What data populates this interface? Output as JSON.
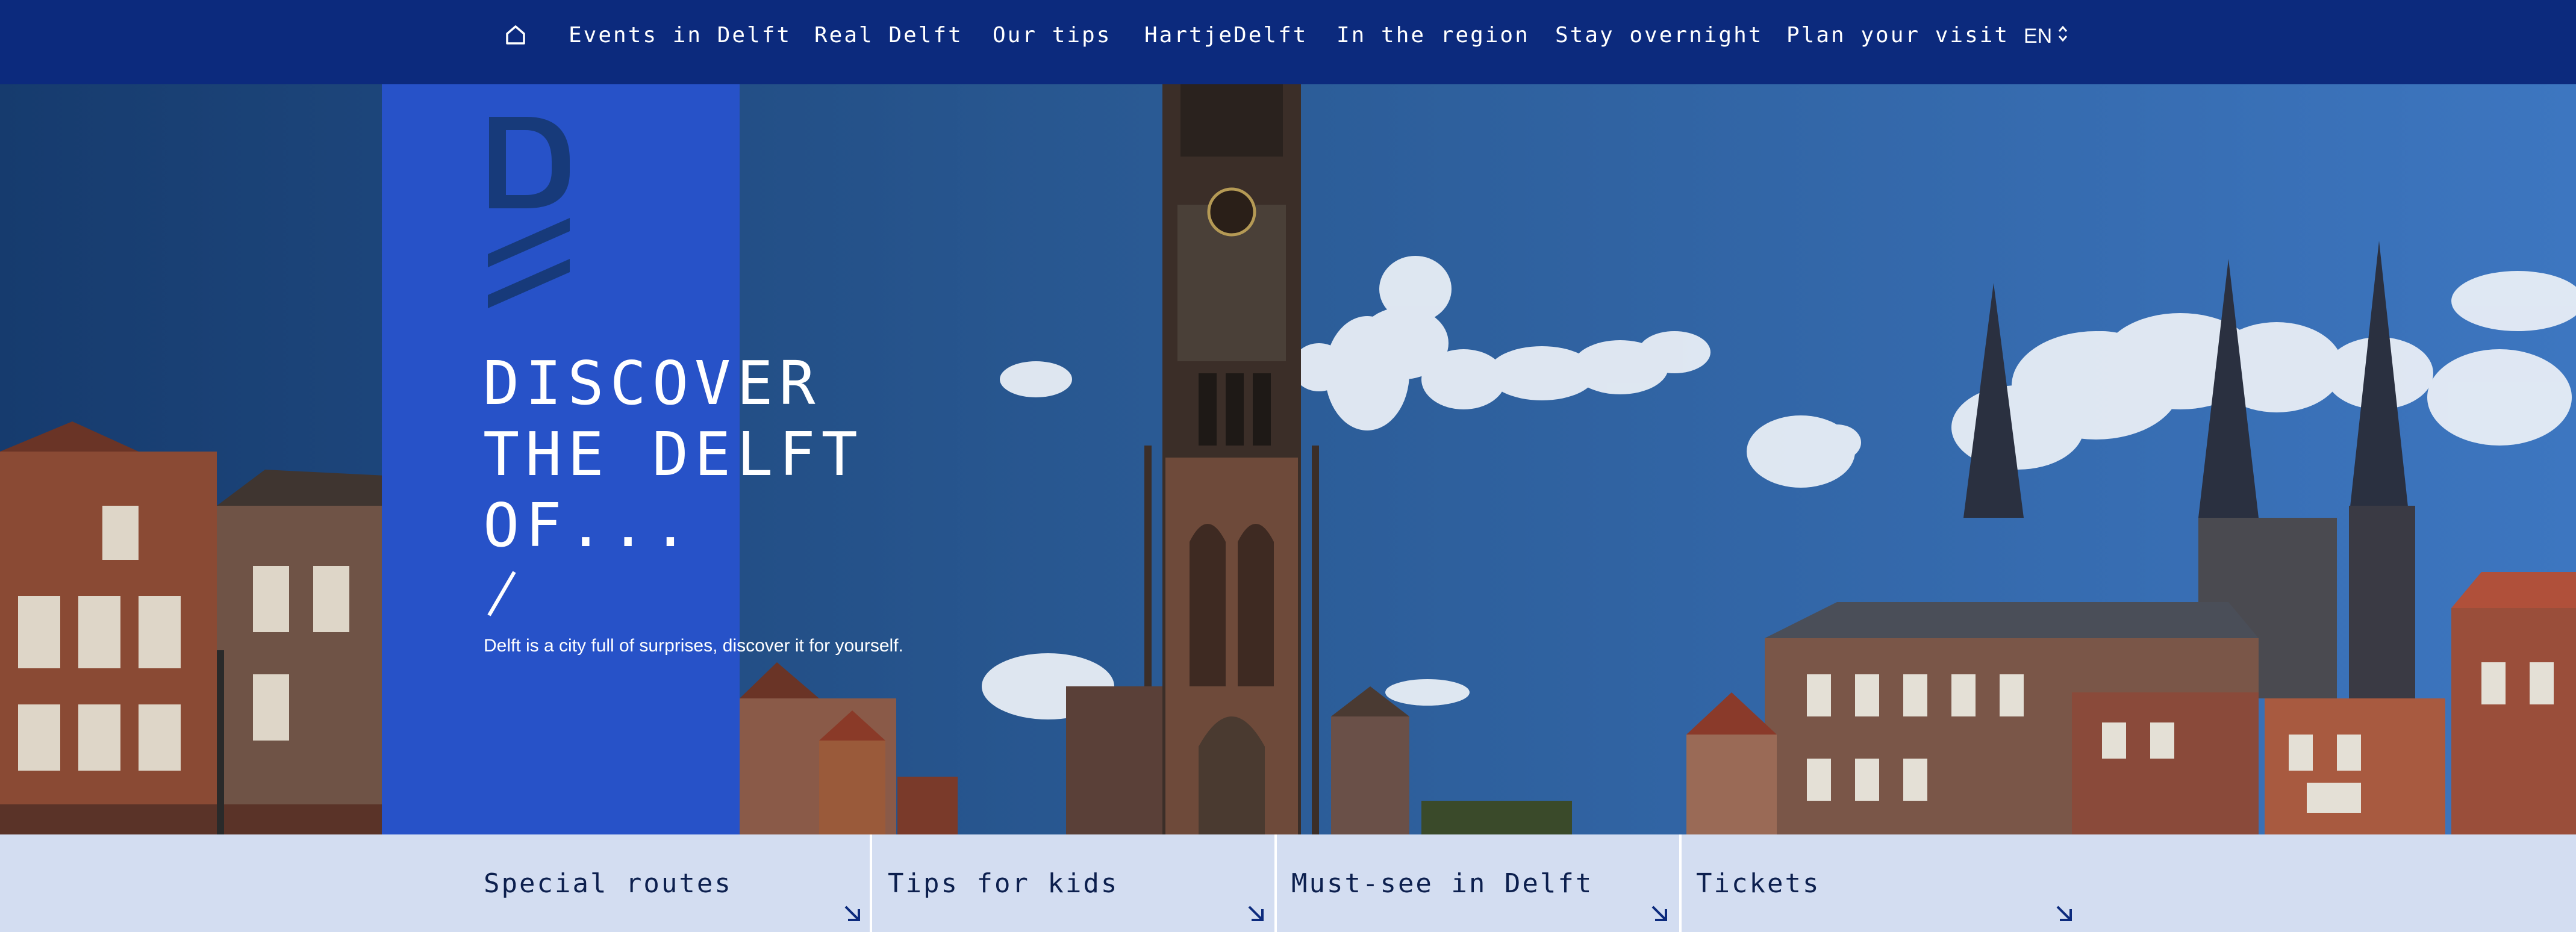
{
  "nav": {
    "home_icon": "home-icon",
    "items": [
      "Events in Delft",
      "Real Delft",
      "Our tips",
      "HartjeDelft",
      "In the region",
      "Stay overnight",
      "Plan your visit"
    ],
    "language": "EN"
  },
  "hero": {
    "headline": "DISCOVER\nTHE DELFT\nOF...",
    "subtitle": "Delft is a city full of surprises, discover it for yourself."
  },
  "cards": [
    {
      "title": "Special routes"
    },
    {
      "title": "Tips for kids"
    },
    {
      "title": "Must-see in Delft"
    },
    {
      "title": "Tickets"
    }
  ],
  "colors": {
    "nav_bg": "#0c2a7d",
    "panel_bg": "#2752c8",
    "card_bg": "#d3ddf1",
    "card_text": "#0c1f4e",
    "logo": "#173a7a"
  }
}
